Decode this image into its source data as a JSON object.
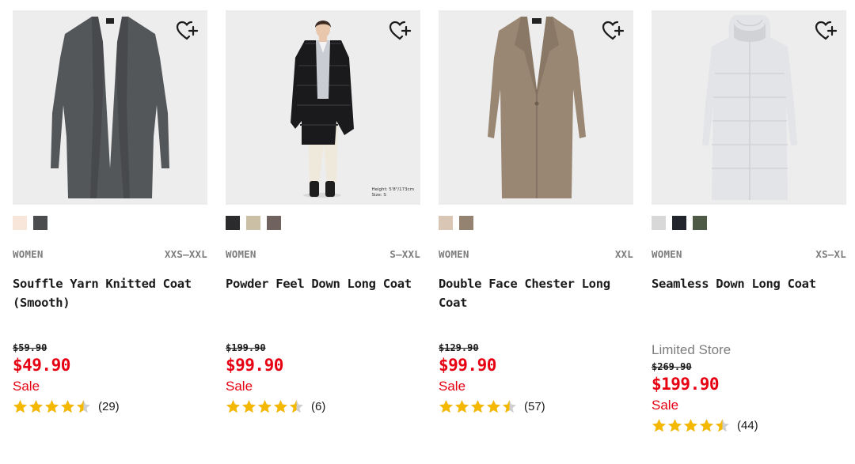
{
  "products": [
    {
      "gender": "WOMEN",
      "sizes": "XXS–XXL",
      "name": "Souffle Yarn Knitted Coat (Smooth)",
      "limited": "",
      "original_price": "$59.90",
      "price": "$49.90",
      "sale_label": "Sale",
      "rating": 4.5,
      "review_count": "(29)",
      "colors": [
        "#f8e6da",
        "#4a4c4e"
      ],
      "favorite_icon": "heart-plus-icon"
    },
    {
      "gender": "WOMEN",
      "sizes": "S–XXL",
      "name": "Powder Feel Down Long Coat",
      "limited": "",
      "original_price": "$199.90",
      "price": "$99.90",
      "sale_label": "Sale",
      "rating": 4.5,
      "review_count": "(6)",
      "colors": [
        "#2b2b2e",
        "#cbbfa6",
        "#6f625f"
      ],
      "model_caption": [
        "Height: 5'8\"/173cm",
        "Size: S"
      ],
      "favorite_icon": "heart-plus-icon"
    },
    {
      "gender": "WOMEN",
      "sizes": "XXL",
      "name": "Double Face Chester Long Coat",
      "limited": "",
      "original_price": "$129.90",
      "price": "$99.90",
      "sale_label": "Sale",
      "rating": 4.5,
      "review_count": "(57)",
      "colors": [
        "#d9c6b4",
        "#948370"
      ],
      "favorite_icon": "heart-plus-icon"
    },
    {
      "gender": "WOMEN",
      "sizes": "XS–XL",
      "name": "Seamless Down Long Coat",
      "limited": "Limited Store",
      "original_price": "$269.90",
      "price": "$199.90",
      "sale_label": "Sale",
      "rating": 4.5,
      "review_count": "(44)",
      "colors": [
        "#d8d8d8",
        "#22252c",
        "#4f5a46"
      ],
      "favorite_icon": "heart-plus-icon"
    }
  ],
  "colors": {
    "sale_red": "#e60012",
    "star_gold": "#f5b800",
    "star_empty": "#cfcfcf",
    "meta_gray": "#7d7d7d",
    "image_bg": "#ededed"
  }
}
